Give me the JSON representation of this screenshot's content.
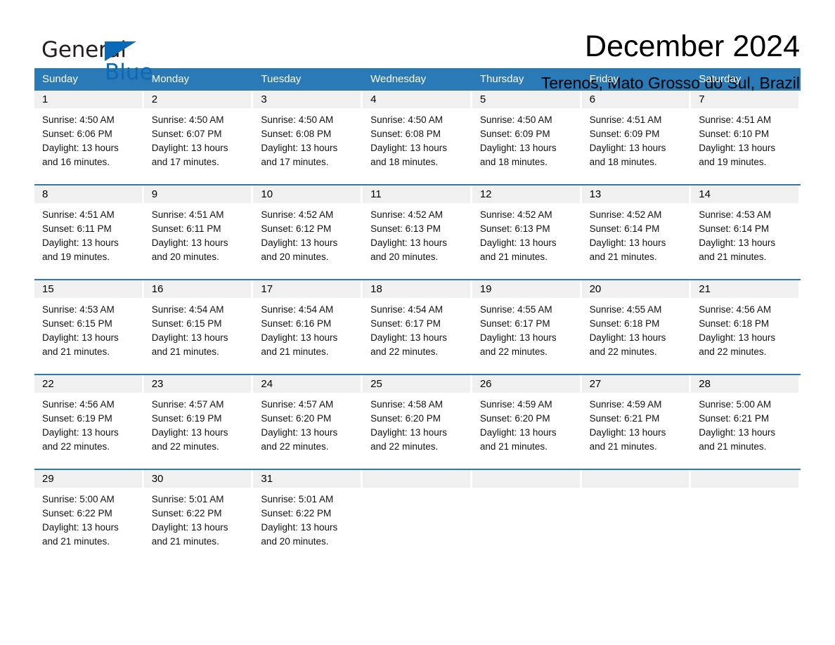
{
  "brand": {
    "name_part1": "General",
    "name_part2": "Blue",
    "triangle_icon": "triangle-icon",
    "accent_color": "#0b6ab8"
  },
  "header": {
    "month_title": "December 2024",
    "location": "Terenos, Mato Grosso do Sul, Brazil"
  },
  "colors": {
    "header_blue": "#2b7ab8",
    "day_band_gray": "#f0f0f0",
    "text_black": "#000000"
  },
  "calendar": {
    "weekdays": [
      "Sunday",
      "Monday",
      "Tuesday",
      "Wednesday",
      "Thursday",
      "Friday",
      "Saturday"
    ],
    "weeks": [
      [
        {
          "day": "1",
          "sunrise": "Sunrise: 4:50 AM",
          "sunset": "Sunset: 6:06 PM",
          "daylight_line1": "Daylight: 13 hours",
          "daylight_line2": "and 16 minutes."
        },
        {
          "day": "2",
          "sunrise": "Sunrise: 4:50 AM",
          "sunset": "Sunset: 6:07 PM",
          "daylight_line1": "Daylight: 13 hours",
          "daylight_line2": "and 17 minutes."
        },
        {
          "day": "3",
          "sunrise": "Sunrise: 4:50 AM",
          "sunset": "Sunset: 6:08 PM",
          "daylight_line1": "Daylight: 13 hours",
          "daylight_line2": "and 17 minutes."
        },
        {
          "day": "4",
          "sunrise": "Sunrise: 4:50 AM",
          "sunset": "Sunset: 6:08 PM",
          "daylight_line1": "Daylight: 13 hours",
          "daylight_line2": "and 18 minutes."
        },
        {
          "day": "5",
          "sunrise": "Sunrise: 4:50 AM",
          "sunset": "Sunset: 6:09 PM",
          "daylight_line1": "Daylight: 13 hours",
          "daylight_line2": "and 18 minutes."
        },
        {
          "day": "6",
          "sunrise": "Sunrise: 4:51 AM",
          "sunset": "Sunset: 6:09 PM",
          "daylight_line1": "Daylight: 13 hours",
          "daylight_line2": "and 18 minutes."
        },
        {
          "day": "7",
          "sunrise": "Sunrise: 4:51 AM",
          "sunset": "Sunset: 6:10 PM",
          "daylight_line1": "Daylight: 13 hours",
          "daylight_line2": "and 19 minutes."
        }
      ],
      [
        {
          "day": "8",
          "sunrise": "Sunrise: 4:51 AM",
          "sunset": "Sunset: 6:11 PM",
          "daylight_line1": "Daylight: 13 hours",
          "daylight_line2": "and 19 minutes."
        },
        {
          "day": "9",
          "sunrise": "Sunrise: 4:51 AM",
          "sunset": "Sunset: 6:11 PM",
          "daylight_line1": "Daylight: 13 hours",
          "daylight_line2": "and 20 minutes."
        },
        {
          "day": "10",
          "sunrise": "Sunrise: 4:52 AM",
          "sunset": "Sunset: 6:12 PM",
          "daylight_line1": "Daylight: 13 hours",
          "daylight_line2": "and 20 minutes."
        },
        {
          "day": "11",
          "sunrise": "Sunrise: 4:52 AM",
          "sunset": "Sunset: 6:13 PM",
          "daylight_line1": "Daylight: 13 hours",
          "daylight_line2": "and 20 minutes."
        },
        {
          "day": "12",
          "sunrise": "Sunrise: 4:52 AM",
          "sunset": "Sunset: 6:13 PM",
          "daylight_line1": "Daylight: 13 hours",
          "daylight_line2": "and 21 minutes."
        },
        {
          "day": "13",
          "sunrise": "Sunrise: 4:52 AM",
          "sunset": "Sunset: 6:14 PM",
          "daylight_line1": "Daylight: 13 hours",
          "daylight_line2": "and 21 minutes."
        },
        {
          "day": "14",
          "sunrise": "Sunrise: 4:53 AM",
          "sunset": "Sunset: 6:14 PM",
          "daylight_line1": "Daylight: 13 hours",
          "daylight_line2": "and 21 minutes."
        }
      ],
      [
        {
          "day": "15",
          "sunrise": "Sunrise: 4:53 AM",
          "sunset": "Sunset: 6:15 PM",
          "daylight_line1": "Daylight: 13 hours",
          "daylight_line2": "and 21 minutes."
        },
        {
          "day": "16",
          "sunrise": "Sunrise: 4:54 AM",
          "sunset": "Sunset: 6:15 PM",
          "daylight_line1": "Daylight: 13 hours",
          "daylight_line2": "and 21 minutes."
        },
        {
          "day": "17",
          "sunrise": "Sunrise: 4:54 AM",
          "sunset": "Sunset: 6:16 PM",
          "daylight_line1": "Daylight: 13 hours",
          "daylight_line2": "and 21 minutes."
        },
        {
          "day": "18",
          "sunrise": "Sunrise: 4:54 AM",
          "sunset": "Sunset: 6:17 PM",
          "daylight_line1": "Daylight: 13 hours",
          "daylight_line2": "and 22 minutes."
        },
        {
          "day": "19",
          "sunrise": "Sunrise: 4:55 AM",
          "sunset": "Sunset: 6:17 PM",
          "daylight_line1": "Daylight: 13 hours",
          "daylight_line2": "and 22 minutes."
        },
        {
          "day": "20",
          "sunrise": "Sunrise: 4:55 AM",
          "sunset": "Sunset: 6:18 PM",
          "daylight_line1": "Daylight: 13 hours",
          "daylight_line2": "and 22 minutes."
        },
        {
          "day": "21",
          "sunrise": "Sunrise: 4:56 AM",
          "sunset": "Sunset: 6:18 PM",
          "daylight_line1": "Daylight: 13 hours",
          "daylight_line2": "and 22 minutes."
        }
      ],
      [
        {
          "day": "22",
          "sunrise": "Sunrise: 4:56 AM",
          "sunset": "Sunset: 6:19 PM",
          "daylight_line1": "Daylight: 13 hours",
          "daylight_line2": "and 22 minutes."
        },
        {
          "day": "23",
          "sunrise": "Sunrise: 4:57 AM",
          "sunset": "Sunset: 6:19 PM",
          "daylight_line1": "Daylight: 13 hours",
          "daylight_line2": "and 22 minutes."
        },
        {
          "day": "24",
          "sunrise": "Sunrise: 4:57 AM",
          "sunset": "Sunset: 6:20 PM",
          "daylight_line1": "Daylight: 13 hours",
          "daylight_line2": "and 22 minutes."
        },
        {
          "day": "25",
          "sunrise": "Sunrise: 4:58 AM",
          "sunset": "Sunset: 6:20 PM",
          "daylight_line1": "Daylight: 13 hours",
          "daylight_line2": "and 22 minutes."
        },
        {
          "day": "26",
          "sunrise": "Sunrise: 4:59 AM",
          "sunset": "Sunset: 6:20 PM",
          "daylight_line1": "Daylight: 13 hours",
          "daylight_line2": "and 21 minutes."
        },
        {
          "day": "27",
          "sunrise": "Sunrise: 4:59 AM",
          "sunset": "Sunset: 6:21 PM",
          "daylight_line1": "Daylight: 13 hours",
          "daylight_line2": "and 21 minutes."
        },
        {
          "day": "28",
          "sunrise": "Sunrise: 5:00 AM",
          "sunset": "Sunset: 6:21 PM",
          "daylight_line1": "Daylight: 13 hours",
          "daylight_line2": "and 21 minutes."
        }
      ],
      [
        {
          "day": "29",
          "sunrise": "Sunrise: 5:00 AM",
          "sunset": "Sunset: 6:22 PM",
          "daylight_line1": "Daylight: 13 hours",
          "daylight_line2": "and 21 minutes."
        },
        {
          "day": "30",
          "sunrise": "Sunrise: 5:01 AM",
          "sunset": "Sunset: 6:22 PM",
          "daylight_line1": "Daylight: 13 hours",
          "daylight_line2": "and 21 minutes."
        },
        {
          "day": "31",
          "sunrise": "Sunrise: 5:01 AM",
          "sunset": "Sunset: 6:22 PM",
          "daylight_line1": "Daylight: 13 hours",
          "daylight_line2": "and 20 minutes."
        },
        {
          "day": "",
          "sunrise": "",
          "sunset": "",
          "daylight_line1": "",
          "daylight_line2": ""
        },
        {
          "day": "",
          "sunrise": "",
          "sunset": "",
          "daylight_line1": "",
          "daylight_line2": ""
        },
        {
          "day": "",
          "sunrise": "",
          "sunset": "",
          "daylight_line1": "",
          "daylight_line2": ""
        },
        {
          "day": "",
          "sunrise": "",
          "sunset": "",
          "daylight_line1": "",
          "daylight_line2": ""
        }
      ]
    ]
  }
}
